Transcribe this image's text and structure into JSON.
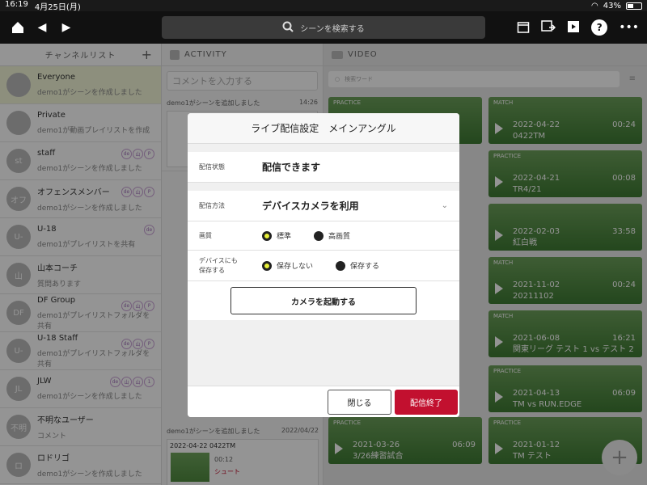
{
  "status_bar": {
    "time": "16:19",
    "date": "4月25日(月)",
    "battery": "43%",
    "battery_level": 0.43
  },
  "topnav": {
    "search_placeholder": "シーンを検索する"
  },
  "channels": {
    "header": "チャンネルリスト",
    "items": [
      {
        "avatar": "",
        "name": "Everyone",
        "sub": "demo1がシーンを作成しました",
        "active": true,
        "badges": []
      },
      {
        "avatar": "",
        "name": "Private",
        "sub": "demo1が動画プレイリストを作成",
        "badges": []
      },
      {
        "avatar": "st",
        "name": "staff",
        "sub": "demo1がシーンを作成しました",
        "badges": [
          "de",
          "山",
          "P"
        ]
      },
      {
        "avatar": "オフ",
        "name": "オフェンスメンバー",
        "sub": "demo1がシーンを作成しました",
        "badges": [
          "de",
          "山",
          "P"
        ]
      },
      {
        "avatar": "U-",
        "name": "U-18",
        "sub": "demo1がプレイリストを共有",
        "badges": [
          "de"
        ]
      },
      {
        "avatar": "山",
        "name": "山本コーチ",
        "sub": "質問あります",
        "badges": []
      },
      {
        "avatar": "DF",
        "name": "DF Group",
        "sub": "demo1がプレイリストフォルダを共有",
        "badges": [
          "de",
          "山",
          "P"
        ]
      },
      {
        "avatar": "U-",
        "name": "U-18 Staff",
        "sub": "demo1がプレイリストフォルダを共有",
        "badges": [
          "de",
          "山",
          "P"
        ]
      },
      {
        "avatar": "JL",
        "name": "JLW",
        "sub": "demo1がシーンを作成しました",
        "badges": [
          "de",
          "山",
          "山",
          "1"
        ]
      },
      {
        "avatar": "不明",
        "name": "不明なユーザー",
        "sub": "コメント",
        "badges": []
      },
      {
        "avatar": "ロ",
        "name": "ロドリゴ",
        "sub": "demo1がシーンを作成しました",
        "badges": []
      }
    ]
  },
  "activity": {
    "header": "ACTIVITY",
    "comment_placeholder": "コメントを入力する",
    "items": [
      {
        "text": "demo1がシーンを追加しました",
        "time": "14:26"
      },
      {
        "text": "demo1がシーンを追加しました",
        "time": "2022/04/22"
      }
    ],
    "last_card": {
      "title": "2022-04-22 0422TM",
      "time": "00:12",
      "tag": "シュート"
    }
  },
  "video": {
    "header": "VIDEO",
    "search_placeholder": "検索ワード",
    "cards": [
      {
        "tag": "PRACTICE",
        "date": "",
        "dur": "",
        "title": ""
      },
      {
        "tag": "MATCH",
        "date": "2022-04-22",
        "dur": "00:24",
        "title": "0422TM"
      },
      {
        "tag": "PRACTICE",
        "date": "2022-04-21",
        "dur": "00:08",
        "title": "TR4/21"
      },
      {
        "tag": "",
        "date": "2022-02-03",
        "dur": "33:58",
        "title": "紅白戦"
      },
      {
        "tag": "MATCH",
        "date": "2021-11-02",
        "dur": "00:24",
        "title": "20211102"
      },
      {
        "tag": "MATCH",
        "date": "2021-06-08",
        "dur": "16:21",
        "title": "関東リーグ テスト 1 vs テスト 2"
      },
      {
        "tag": "PRACTICE",
        "date": "2021-04-13",
        "dur": "06:09",
        "title": "TM vs RUN.EDGE"
      },
      {
        "tag": "PRACTICE",
        "date": "2021-03-26",
        "dur": "06:09",
        "title": "3/26練習試合"
      },
      {
        "tag": "PRACTICE",
        "date": "2021-01-12",
        "dur": "",
        "title": "TM テスト"
      }
    ]
  },
  "modal": {
    "title": "ライブ配信設定　メインアングル",
    "status_label": "配信状態",
    "status_value": "配信できます",
    "method_label": "配信方法",
    "method_value": "デバイスカメラを利用",
    "quality_label": "画質",
    "quality_options": [
      {
        "label": "標準",
        "selected": true
      },
      {
        "label": "高画質",
        "selected": false
      }
    ],
    "save_label_1": "デバイスにも",
    "save_label_2": "保存する",
    "save_options": [
      {
        "label": "保存しない",
        "selected": true
      },
      {
        "label": "保存する",
        "selected": false
      }
    ],
    "camera_button": "カメラを起動する",
    "close_button": "閉じる",
    "end_button": "配信終了"
  }
}
